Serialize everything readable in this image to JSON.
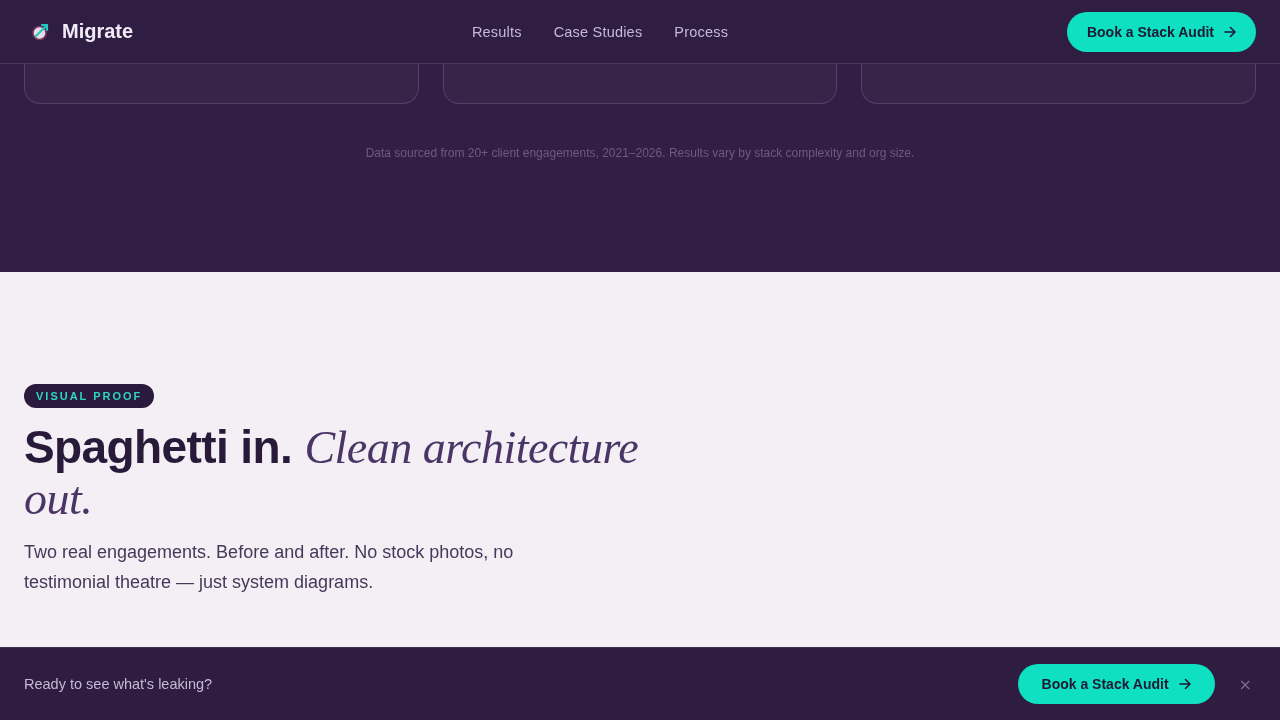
{
  "header": {
    "logo": "Migrate",
    "nav": [
      {
        "label": "Results"
      },
      {
        "label": "Case Studies"
      },
      {
        "label": "Process"
      }
    ],
    "cta": "Book a Stack Audit"
  },
  "stats": {
    "note": "Data sourced from 20+ client engagements, 2021–2026. Results vary by stack complexity and org size."
  },
  "proof": {
    "badge": "VISUAL PROOF",
    "title": "Spaghetti in.",
    "title_accent": "Clean architecture out.",
    "lead": "Two real engagements. Before and after. No stock photos, no testimonial theatre — just system diagrams."
  },
  "cta_bar": {
    "text": "Ready to see what's leaking?",
    "button": "Book a Stack Audit",
    "close": "×"
  }
}
